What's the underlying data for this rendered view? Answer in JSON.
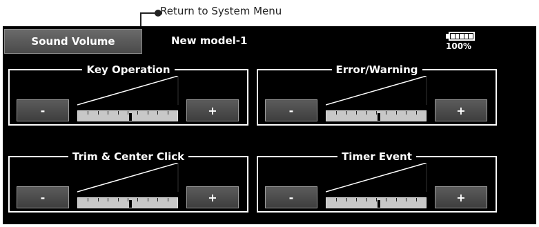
{
  "callout": {
    "label": "Return to System Menu"
  },
  "header": {
    "title_button": "Sound Volume",
    "model_name": "New model-1",
    "battery_percent": "100%",
    "battery_level": 1.0
  },
  "groups": [
    {
      "title": "Key Operation",
      "minus_label": "-",
      "plus_label": "+",
      "level": 0.5
    },
    {
      "title": "Error/Warning",
      "minus_label": "-",
      "plus_label": "+",
      "level": 0.5
    },
    {
      "title": "Trim & Center Click",
      "minus_label": "-",
      "plus_label": "+",
      "level": 0.5
    },
    {
      "title": "Timer Event",
      "minus_label": "-",
      "plus_label": "+",
      "level": 0.5
    }
  ]
}
